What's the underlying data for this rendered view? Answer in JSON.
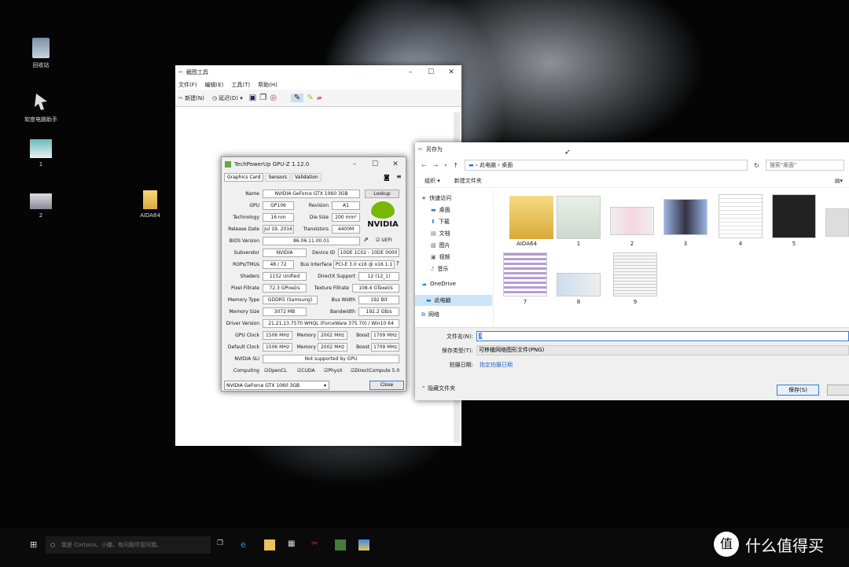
{
  "desktop": {
    "icons": [
      {
        "label": "回收站"
      },
      {
        "label": "软度电脑助手"
      },
      {
        "label": "1"
      },
      {
        "label": "2"
      },
      {
        "label": "AIDA64"
      }
    ]
  },
  "snip": {
    "title": "截图工具",
    "menu": [
      "文件(F)",
      "编辑(E)",
      "工具(T)",
      "帮助(H)"
    ],
    "new_label": "新建(N)",
    "delay_label": "延迟(D)"
  },
  "gpuz": {
    "title": "TechPowerUp GPU-Z 1.12.0",
    "tabs": [
      "Graphics Card",
      "Sensors",
      "Validation"
    ],
    "name_label": "Name",
    "name": "NVIDIA GeForce GTX 1060 3GB",
    "lookup": "Lookup",
    "gpu_label": "GPU",
    "gpu": "GP106",
    "revision_label": "Revision",
    "revision": "A1",
    "tech_label": "Technology",
    "tech": "16 nm",
    "die_label": "Die Size",
    "die": "200 mm²",
    "release_label": "Release Date",
    "release": "Jul 19, 2016",
    "trans_label": "Transistors",
    "trans": "4400M",
    "bios_label": "BIOS Version",
    "bios": "86.06.11.00.01",
    "uefi": "UEFI",
    "subvendor_label": "Subvendor",
    "subvendor": "NVIDIA",
    "devid_label": "Device ID",
    "devid": "10DE 1C02 - 10DE 0000",
    "rops_label": "ROPs/TMUs",
    "rops": "48 / 72",
    "bus_label": "Bus Interface",
    "bus": "PCI-E 3.0 x16 @ x16 1.1",
    "shaders_label": "Shaders",
    "shaders": "1152 Unified",
    "dx_label": "DirectX Support",
    "dx": "12 (12_1)",
    "pixel_label": "Pixel Fillrate",
    "pixel": "72.3 GPixel/s",
    "texture_label": "Texture Fillrate",
    "texture": "108.4 GTexel/s",
    "memtype_label": "Memory Type",
    "memtype": "GDDR5 (Samsung)",
    "buswidth_label": "Bus Width",
    "buswidth": "192 Bit",
    "memsize_label": "Memory Size",
    "memsize": "3072 MB",
    "bandwidth_label": "Bandwidth",
    "bandwidth": "192.2 GB/s",
    "driver_label": "Driver Version",
    "driver": "21.21.13.7570 WHQL (ForceWare 375.70) / Win10 64",
    "gpuclock_label": "GPU Clock",
    "gpuclock": "1506 MHz",
    "mem_label": "Memory",
    "memclock": "2002 MHz",
    "boost_label": "Boost",
    "boost": "1709 MHz",
    "defclock_label": "Default Clock",
    "defclock": "1506 MHz",
    "defmem": "2002 MHz",
    "defboost": "1709 MHz",
    "sli_label": "NVIDIA SLI",
    "sli": "Not supported by GPU",
    "computing_label": "Computing",
    "opencl": "OpenCL",
    "cuda": "CUDA",
    "physx": "PhysX",
    "directcompute": "DirectCompute 5.0",
    "select": "NVIDIA GeForce GTX 1060 3GB",
    "close": "Close",
    "logo": "NVIDIA"
  },
  "saveas": {
    "title": "另存为",
    "path": [
      "此电脑",
      "桌面"
    ],
    "search_placeholder": "搜索\"桌面\"",
    "organize": "组织 ▾",
    "newfolder": "新建文件夹",
    "nav": [
      "快速访问",
      "桌面",
      "下载",
      "文档",
      "图片",
      "视频",
      "音乐",
      "OneDrive",
      "此电脑",
      "网络"
    ],
    "files": [
      "AIDA64",
      "1",
      "2",
      "3",
      "4",
      "5",
      "7",
      "8",
      "9"
    ],
    "filename_label": "文件名(N):",
    "filename": "3",
    "type_label": "保存类型(T):",
    "type": "可移植网络图形文件(PNG)",
    "date_label": "拍摄日期:",
    "date": "指定拍摄日期",
    "hide": "隐藏文件夹",
    "save": "保存(S)"
  },
  "taskbar": {
    "search_placeholder": "我是 Cortana，小娜。有问题尽管问我。"
  },
  "watermark": "什么值得买"
}
